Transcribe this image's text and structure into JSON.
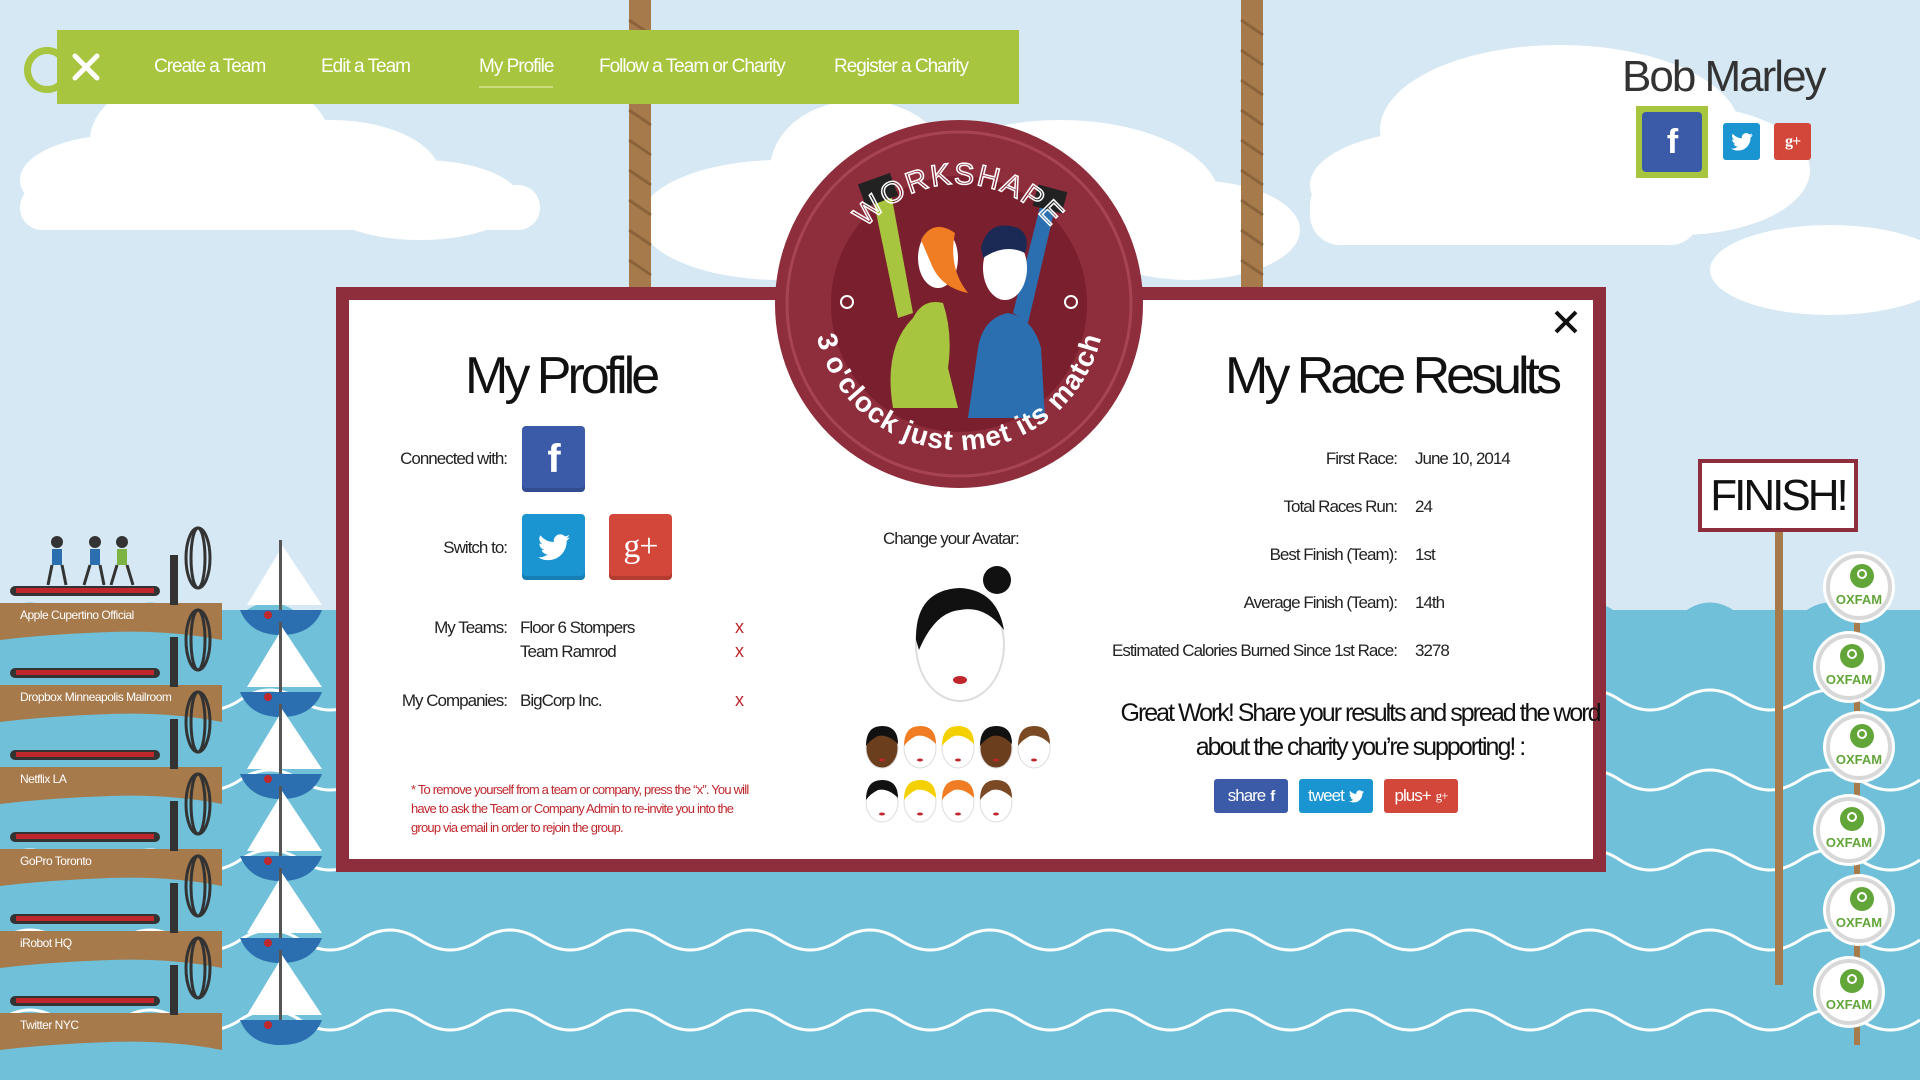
{
  "nav": {
    "items": [
      {
        "label": "Create a Team",
        "active": false
      },
      {
        "label": "Edit a Team",
        "active": false
      },
      {
        "label": "My Profile",
        "active": true
      },
      {
        "label": "Follow a Team or Charity",
        "active": false
      },
      {
        "label": "Register a Charity",
        "active": false
      }
    ],
    "close_icon": "close-icon"
  },
  "user": {
    "name": "Bob Marley",
    "networks": [
      "facebook",
      "twitter",
      "google-plus"
    ],
    "active_network": "facebook"
  },
  "logo": {
    "brand": "WORKSHAPE",
    "tagline": "3 o'clock just met its match"
  },
  "profile": {
    "title": "My Profile",
    "connected_label": "Connected with:",
    "switch_label": "Switch to:",
    "teams_label": "My Teams:",
    "teams": [
      "Floor 6 Stompers",
      "Team Ramrod"
    ],
    "companies_label": "My Companies:",
    "companies": [
      "BigCorp Inc."
    ],
    "remove_glyph": "x",
    "note": "* To remove yourself from a team or company, press the “x”. You will have to ask the Team or Company Admin to re-invite you into the group via email in order to rejoin the group."
  },
  "avatar": {
    "title": "Change your Avatar:",
    "options": [
      {
        "skin": "#6b3e1e",
        "hair": "#111111"
      },
      {
        "skin": "#ffffff",
        "hair": "#f07d23"
      },
      {
        "skin": "#ffffff",
        "hair": "#f5d000"
      },
      {
        "skin": "#6b3e1e",
        "hair": "#111111"
      },
      {
        "skin": "#ffffff",
        "hair": "#7b4a25"
      },
      {
        "skin": "#ffffff",
        "hair": "#111111"
      },
      {
        "skin": "#ffffff",
        "hair": "#f5d000"
      },
      {
        "skin": "#ffffff",
        "hair": "#f07d23"
      },
      {
        "skin": "#ffffff",
        "hair": "#7b4a25"
      }
    ]
  },
  "results": {
    "title": "My Race Results",
    "rows": [
      {
        "label": "First Race:",
        "value": "June 10, 2014"
      },
      {
        "label": "Total Races Run:",
        "value": "24"
      },
      {
        "label": "Best Finish (Team):",
        "value": "1st"
      },
      {
        "label": "Average Finish (Team):",
        "value": "14th"
      },
      {
        "label": "Estimated Calories Burned Since 1st Race:",
        "value": "3278"
      }
    ],
    "share_text": "Great  Work! Share your results and spread the word about the charity you’re supporting! :",
    "share_buttons": [
      {
        "label": "share",
        "icon": "facebook-icon",
        "color": "#3b5ba8"
      },
      {
        "label": "tweet",
        "icon": "twitter-icon",
        "color": "#1b95d2"
      },
      {
        "label": "plus+",
        "icon": "google-plus-icon",
        "color": "#d3473a"
      }
    ]
  },
  "teams_race": [
    "Apple Cupertino Official",
    "Dropbox Minneapolis Mailroom",
    "Netflix LA",
    "GoPro Toronto",
    "iRobot HQ",
    "Twitter NYC"
  ],
  "finish": {
    "label": "FINISH!"
  },
  "charities": [
    {
      "name": "OXFAM"
    },
    {
      "name": "OXFAM"
    },
    {
      "name": "OXFAM"
    },
    {
      "name": "OXFAM"
    },
    {
      "name": "OXFAM"
    },
    {
      "name": "OXFAM"
    }
  ],
  "colors": {
    "accent_green": "#a7c53f",
    "frame_maroon": "#8e2d3c",
    "sea": "#6fc0d8",
    "sky": "#d6e8f3",
    "remove_red": "#c0272d"
  }
}
